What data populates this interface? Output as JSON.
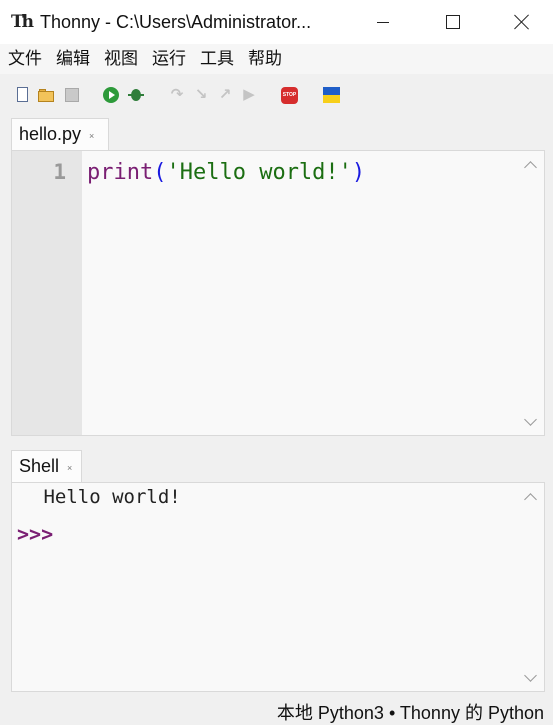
{
  "window": {
    "app_icon": "Th",
    "title": "Thonny  -  C:\\Users\\Administrator..."
  },
  "menu": [
    "文件",
    "编辑",
    "视图",
    "运行",
    "工具",
    "帮助"
  ],
  "toolbar": {
    "icons": [
      "new-file-icon",
      "open-file-icon",
      "save-file-icon",
      "run-icon",
      "debug-icon",
      "step-over-icon",
      "step-into-icon",
      "step-out-icon",
      "resume-icon",
      "stop-icon",
      "ukraine-flag-icon"
    ],
    "stop_text": "STOP"
  },
  "editor": {
    "tab_label": "hello.py",
    "tab_close": "×",
    "line_numbers": [
      "1"
    ],
    "code": {
      "keyword": "print",
      "open_paren": "(",
      "string": "'Hello world!'",
      "close_paren": ")"
    }
  },
  "shell": {
    "tab_label": "Shell",
    "tab_close": "×",
    "output": " Hello world!",
    "prompt": ">>>"
  },
  "status": {
    "text": "本地 Python3  •  Thonny 的 Python"
  },
  "colors": {
    "keyword": "#7a1f73",
    "paren": "#1a1ae0",
    "string": "#1b6e12",
    "prompt": "#7a1f73"
  }
}
